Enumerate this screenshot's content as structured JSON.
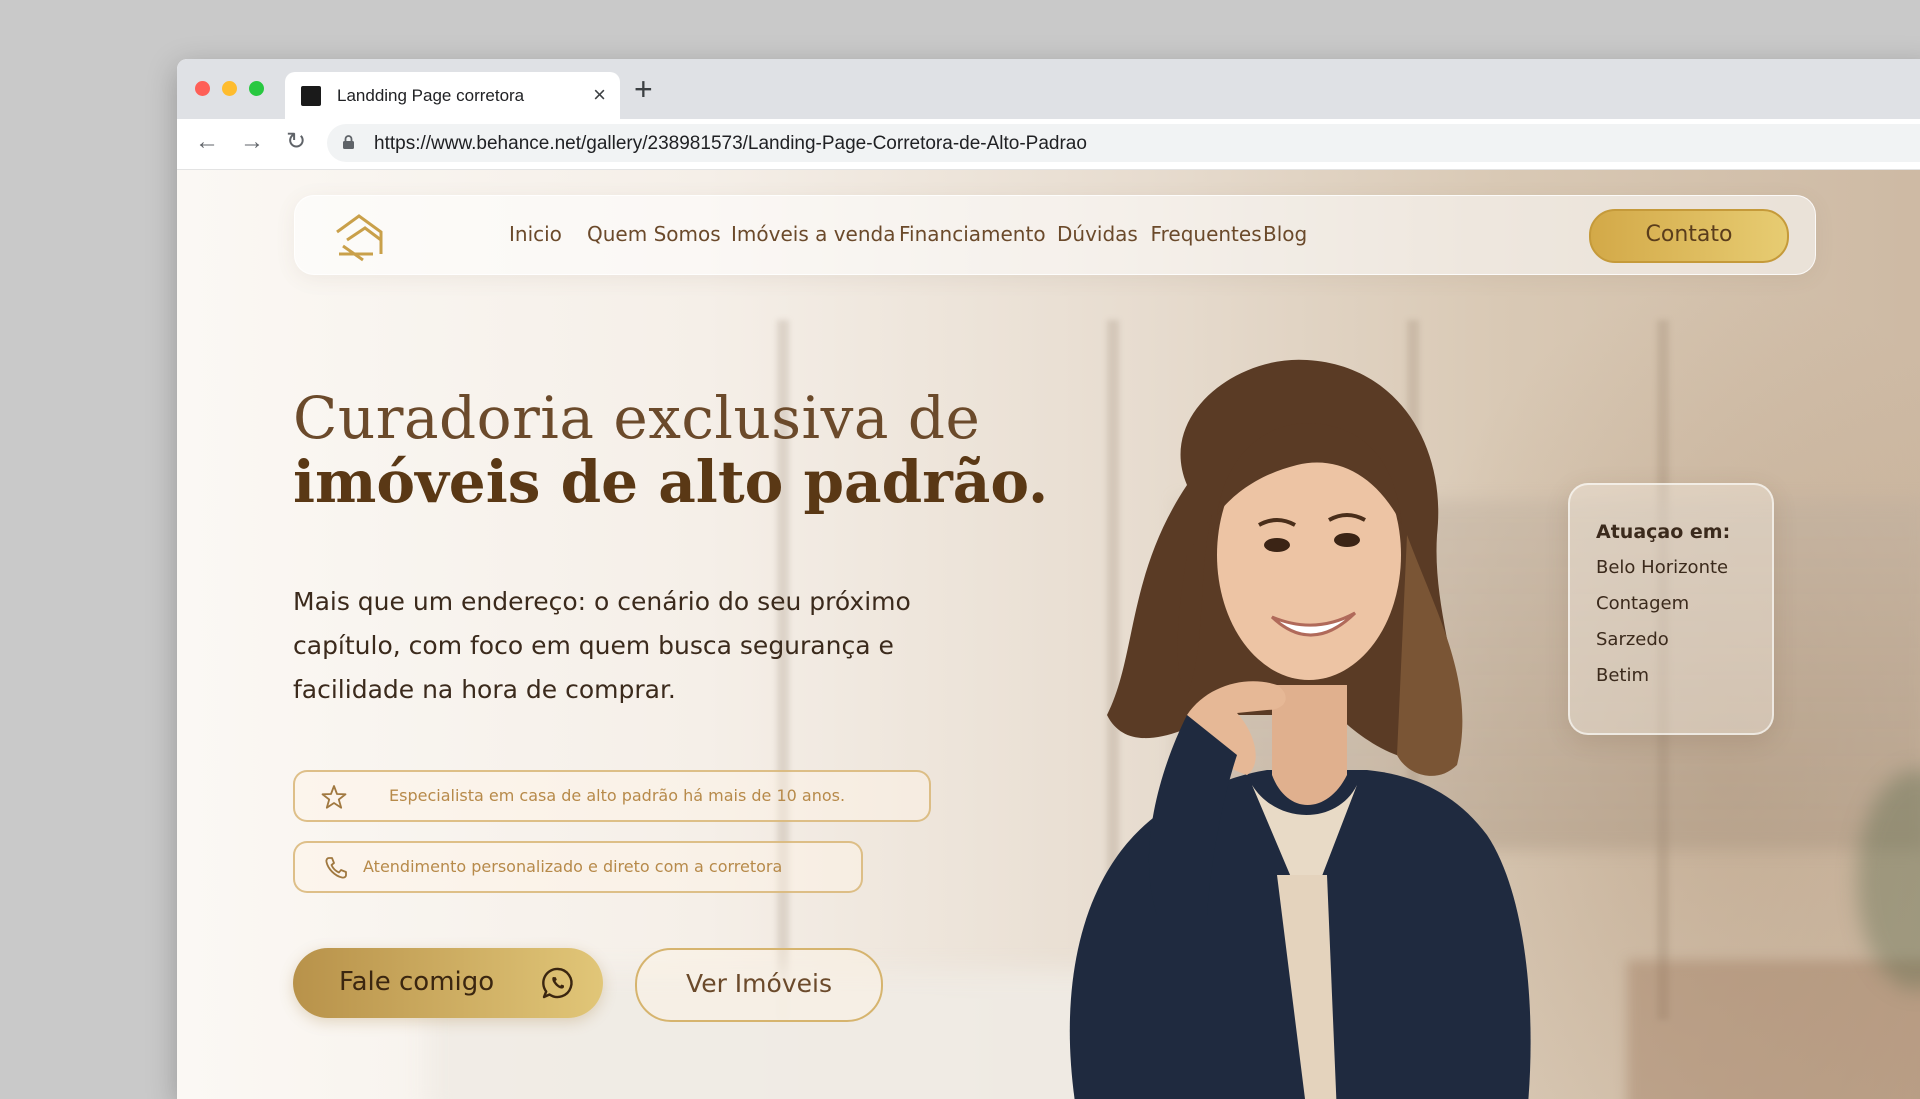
{
  "browser": {
    "tab_title": "Landding Page corretora",
    "url": "https://www.behance.net/gallery/238981573/Landing-Page-Corretora-de-Alto-Padrao"
  },
  "nav": {
    "items": [
      "Inicio",
      "Quem Somos",
      "Imóveis a venda",
      "Financiamento",
      "Dúvidas  Frequentes",
      "Blog"
    ],
    "cta": "Contato"
  },
  "hero": {
    "headline_line1": "Curadoria exclusiva de",
    "headline_line2": "imóveis de alto padrão.",
    "subtitle": "Mais que um endereço: o cenário do seu próximo capítulo, com foco em quem busca segurança e facilidade na hora de comprar.",
    "features": [
      {
        "icon": "star-icon",
        "text": "Especialista em casa de alto padrão há mais de 10 anos."
      },
      {
        "icon": "phone-icon",
        "text": "Atendimento personalizado e direto com a corretora"
      }
    ],
    "primary_button": "Fale comigo",
    "secondary_button": "Ver Imóveis"
  },
  "atuacao": {
    "title": "Atuaçao em:",
    "cities": [
      "Belo Horizonte",
      "Contagem",
      "Sarzedo",
      "Betim"
    ]
  },
  "colors": {
    "brand_gold": "#d3a948",
    "brand_brown": "#6b4a2b"
  }
}
